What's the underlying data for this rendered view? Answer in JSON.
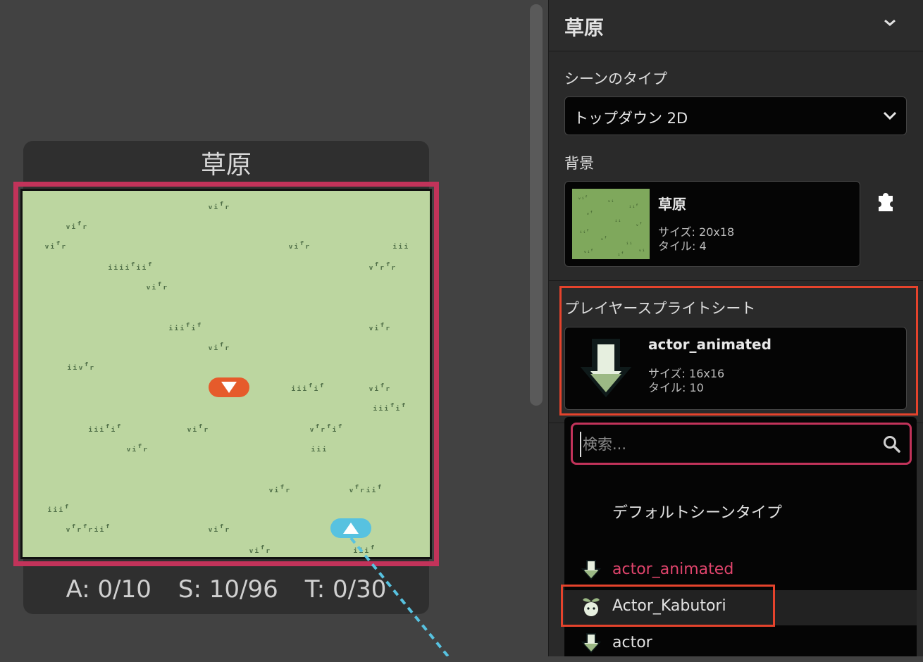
{
  "scene": {
    "title": "草原",
    "stats": {
      "actors": "A: 0/10",
      "sprites": "S: 10/96",
      "triggers": "T: 0/30"
    }
  },
  "sidebar": {
    "title": "草原",
    "scene_type_label": "シーンのタイプ",
    "scene_type_value": "トップダウン 2D",
    "background_label": "背景",
    "background": {
      "name": "草原",
      "size_label": "サイズ:",
      "size": "20x18",
      "tiles_label": "タイル:",
      "tiles": "4"
    },
    "player_sprite_label": "プレイヤースプライトシート",
    "player_sprite": {
      "name": "actor_animated",
      "size_label": "サイズ:",
      "size": "16x16",
      "tiles_label": "タイル:",
      "tiles": "10"
    }
  },
  "dropdown": {
    "search_placeholder": "検索...",
    "options": [
      {
        "label": "デフォルトシーンタイプ",
        "icon": "none",
        "selected": false
      },
      {
        "label": "actor_animated",
        "icon": "down-arrow-sprite-icon",
        "selected": true
      },
      {
        "label": "Actor_Kabutori",
        "icon": "sprout-sprite-icon",
        "selected": false,
        "highlighted": true
      },
      {
        "label": "actor",
        "icon": "down-arrow-sprite-icon",
        "selected": false
      }
    ]
  },
  "colors": {
    "accent_highlight": "#c2335a",
    "annotation_box": "#e5432c",
    "selected_text": "#e0446c",
    "grass_bg": "#bcd6a0"
  }
}
